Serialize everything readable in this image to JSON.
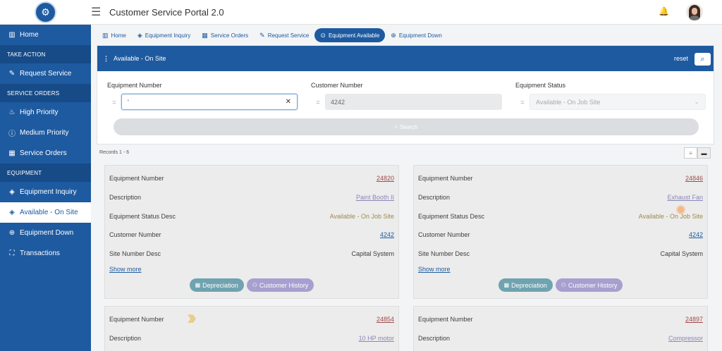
{
  "header": {
    "title": "Customer Service Portal 2.0"
  },
  "sidebar": {
    "items": [
      {
        "type": "item",
        "icon": "bar-chart-icon",
        "glyph": "▥",
        "label": "Home"
      },
      {
        "type": "section",
        "label": "TAKE ACTION"
      },
      {
        "type": "item",
        "icon": "pencil-icon",
        "glyph": "✎",
        "label": "Request Service"
      },
      {
        "type": "section",
        "label": "SERVICE ORDERS"
      },
      {
        "type": "item",
        "icon": "fire-icon",
        "glyph": "♨",
        "label": "High Priority"
      },
      {
        "type": "item",
        "icon": "info-icon",
        "glyph": "ⓘ",
        "label": "Medium Priority"
      },
      {
        "type": "item",
        "icon": "grid-icon",
        "glyph": "▦",
        "label": "Service Orders"
      },
      {
        "type": "section",
        "label": "EQUIPMENT"
      },
      {
        "type": "item",
        "icon": "layers-icon",
        "glyph": "◈",
        "label": "Equipment Inquiry"
      },
      {
        "type": "item",
        "icon": "layers-icon",
        "glyph": "◈",
        "label": "Available - On Site",
        "active": true
      },
      {
        "type": "item",
        "icon": "arrow-circle-down-icon",
        "glyph": "⊕",
        "label": "Equipment Down"
      },
      {
        "type": "item",
        "icon": "expand-icon",
        "glyph": "⛶",
        "label": "Transactions"
      }
    ]
  },
  "tabs": [
    {
      "icon": "bar-chart-icon",
      "glyph": "▥",
      "label": "Home"
    },
    {
      "icon": "layers-icon",
      "glyph": "◈",
      "label": "Equipment Inquiry"
    },
    {
      "icon": "grid-icon",
      "glyph": "▦",
      "label": "Service Orders"
    },
    {
      "icon": "pencil-icon",
      "glyph": "✎",
      "label": "Request Service"
    },
    {
      "icon": "arrow-circle-up-icon",
      "glyph": "⊙",
      "label": "Equipment Available",
      "active": true
    },
    {
      "icon": "arrow-circle-down-icon",
      "glyph": "⊕",
      "label": "Equipment Down"
    }
  ],
  "panel": {
    "title": "Available - On Site",
    "reset_label": "reset",
    "search_label": "Search",
    "fields": {
      "equipment_number": {
        "label": "Equipment Number",
        "operator": "=",
        "value": "'"
      },
      "customer_number": {
        "label": "Customer Number",
        "operator": "=",
        "value": "4242"
      },
      "equipment_status": {
        "label": "Equipment Status",
        "operator": "=",
        "value": "Available - On Job Site"
      }
    }
  },
  "records_label": "Records  1 - 6",
  "card_labels": {
    "equipment_number": "Equipment Number",
    "description": "Description",
    "status": "Equipment Status Desc",
    "customer": "Customer Number",
    "site": "Site Number Desc",
    "show_more": "Show more",
    "depreciation": "Depreciation",
    "history": "Customer History"
  },
  "cards": [
    {
      "equipment_number": "24820",
      "description": "Paint Booth II",
      "status": "Available - On Job Site",
      "customer": "4242",
      "site": "Capital System"
    },
    {
      "equipment_number": "24846",
      "description": "Exhaust Fan",
      "status": "Available - On Job Site",
      "customer": "4242",
      "site": "Capital System"
    },
    {
      "equipment_number": "24854",
      "description": "10 HP motor"
    },
    {
      "equipment_number": "24897",
      "description": "Compressor"
    }
  ],
  "colors": {
    "primary": "#1e5aa0",
    "link_red": "#a0494a",
    "status_gold": "#9b8a4e"
  }
}
